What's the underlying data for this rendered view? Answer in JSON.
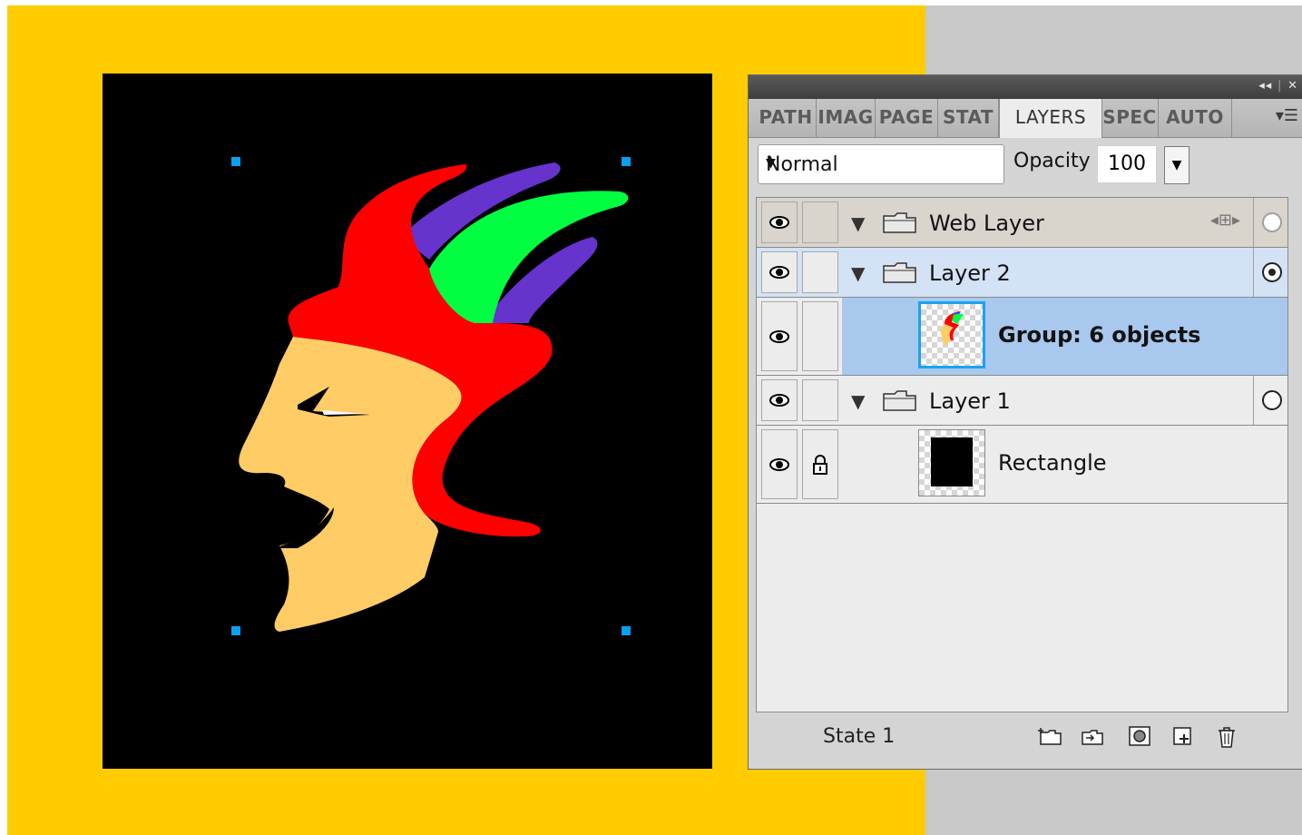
{
  "colors": {
    "workspace_background": "#ffcc00",
    "canvas_background": "#000000",
    "selection_handle": "#0a9ff0",
    "selected_row": "#a8c8ee",
    "hover_row": "#d3e2f4"
  },
  "artwork": {
    "subject": "jester-head illustration",
    "fills": [
      "#ff0000",
      "#6633cc",
      "#00ff40",
      "#ffcc66",
      "#000000",
      "#ffffff"
    ]
  },
  "panel": {
    "tabs": [
      {
        "label": "PATH"
      },
      {
        "label": "IMAG"
      },
      {
        "label": "PAGE"
      },
      {
        "label": "STAT"
      },
      {
        "label": "LAYERS"
      },
      {
        "label": "SPEC"
      },
      {
        "label": "AUTO"
      }
    ],
    "active_tab": "LAYERS",
    "blend_mode": "Normal",
    "opacity_label": "Opacity",
    "opacity_value": "100",
    "layers": [
      {
        "name": "Web Layer",
        "type": "folder",
        "visible": true,
        "locked": false
      },
      {
        "name": "Layer 2",
        "type": "folder",
        "visible": true,
        "locked": false,
        "current": true
      },
      {
        "name": "Group: 6 objects",
        "type": "object",
        "visible": true,
        "locked": false,
        "selected": true
      },
      {
        "name": "Layer 1",
        "type": "folder",
        "visible": true,
        "locked": false
      },
      {
        "name": "Rectangle",
        "type": "object",
        "visible": true,
        "locked": true
      }
    ],
    "footer": {
      "state": "State 1",
      "icons": [
        "new-sub-layer-icon",
        "share-layer-icon",
        "add-mask-icon",
        "new-layer-icon",
        "trash-icon"
      ]
    }
  }
}
